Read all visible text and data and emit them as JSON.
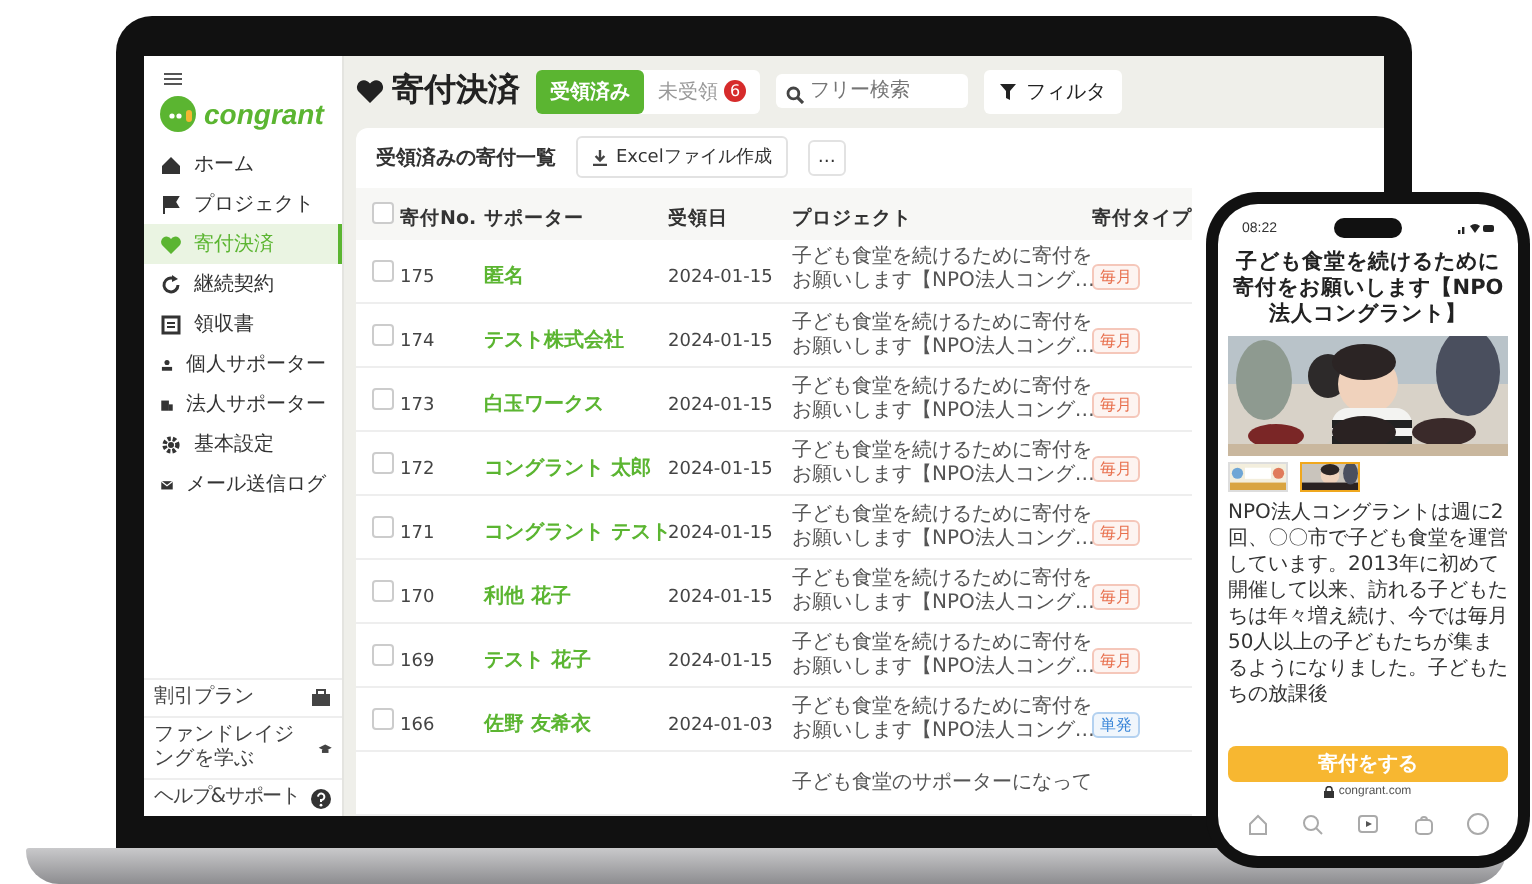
{
  "sidebar": {
    "logo": "congrant",
    "items": [
      {
        "label": "ホーム",
        "selected": false
      },
      {
        "label": "プロジェクト",
        "selected": false
      },
      {
        "label": "寄付決済",
        "selected": true
      },
      {
        "label": "継続契約",
        "selected": false
      },
      {
        "label": "領収書",
        "selected": false
      },
      {
        "label": "個人サポーター",
        "selected": false
      },
      {
        "label": "法人サポーター",
        "selected": false
      },
      {
        "label": "基本設定",
        "selected": false
      },
      {
        "label": "メール送信ログ",
        "selected": false
      }
    ],
    "footer_items": [
      {
        "label": "割引プラン"
      },
      {
        "label": "ファンドレイジングを学ぶ"
      },
      {
        "label": "ヘルプ&サポート"
      }
    ]
  },
  "header": {
    "title": "寄付決済",
    "tabs": [
      {
        "label": "受領済み",
        "selected": true
      },
      {
        "label": "未受領",
        "selected": false,
        "badge": "6"
      }
    ],
    "search": {
      "placeholder": "フリー検索"
    },
    "filter_button": "フィルタ"
  },
  "card": {
    "title": "受領済みの寄付一覧",
    "export_button": "Excelファイル作成",
    "more_button": "…",
    "table": {
      "all_checked": false,
      "columns": [
        "寄付No.",
        "サポーター",
        "受領日",
        "プロジェクト",
        "寄付タイプ"
      ],
      "rows": [
        {
          "checked": false,
          "no": "175",
          "supporter": "匿名",
          "date": "2024-01-15",
          "project": [
            "子ども食堂を続けるために寄付を",
            "お願いします【NPO法人コング…"
          ],
          "type": {
            "label": "毎月",
            "color": "#e8704e"
          }
        },
        {
          "checked": false,
          "no": "174",
          "supporter": "テスト株式会社",
          "date": "2024-01-15",
          "project": [
            "子ども食堂を続けるために寄付を",
            "お願いします【NPO法人コング…"
          ],
          "type": {
            "label": "毎月",
            "color": "#e8704e"
          }
        },
        {
          "checked": false,
          "no": "173",
          "supporter": "白玉ワークス",
          "date": "2024-01-15",
          "project": [
            "子ども食堂を続けるために寄付を",
            "お願いします【NPO法人コング…"
          ],
          "type": {
            "label": "毎月",
            "color": "#e8704e"
          }
        },
        {
          "checked": false,
          "no": "172",
          "supporter": "コングラント 太郎",
          "date": "2024-01-15",
          "project": [
            "子ども食堂を続けるために寄付を",
            "お願いします【NPO法人コング…"
          ],
          "type": {
            "label": "毎月",
            "color": "#e8704e"
          }
        },
        {
          "checked": false,
          "no": "171",
          "supporter": "コングラント テスト",
          "date": "2024-01-15",
          "project": [
            "子ども食堂を続けるために寄付を",
            "お願いします【NPO法人コング…"
          ],
          "type": {
            "label": "毎月",
            "color": "#e8704e"
          }
        },
        {
          "checked": false,
          "no": "170",
          "supporter": "利他 花子",
          "date": "2024-01-15",
          "project": [
            "子ども食堂を続けるために寄付を",
            "お願いします【NPO法人コング…"
          ],
          "type": {
            "label": "毎月",
            "color": "#e8704e"
          }
        },
        {
          "checked": false,
          "no": "169",
          "supporter": "テスト 花子",
          "date": "2024-01-15",
          "project": [
            "子ども食堂を続けるために寄付を",
            "お願いします【NPO法人コング…"
          ],
          "type": {
            "label": "毎月",
            "color": "#e8704e"
          }
        },
        {
          "checked": false,
          "no": "166",
          "supporter": "佐野 友希衣",
          "date": "2024-01-03",
          "project": [
            "子ども食堂を続けるために寄付を",
            "お願いします【NPO法人コング…"
          ],
          "type": {
            "label": "単発",
            "color": "#3a86d8"
          }
        },
        {
          "project": [
            "子ども食堂のサポーターになって"
          ]
        }
      ]
    }
  },
  "phone": {
    "time": "08:22",
    "title": "子ども食堂を続けるために寄付をお願いします【NPO法人コングラント】",
    "thumbnails": [
      {
        "selected": false
      },
      {
        "selected": true
      }
    ],
    "body": "NPO法人コングラントは週に2回、〇〇市で子ども食堂を運営しています。2013年に初めて開催して以来、訪れる子どもたちは年々増え続け、今では毎月50人以上の子どもたちが集まるようになりました。子どもたちの放課後",
    "donate_button": "寄付をする",
    "url": "congrant.com"
  }
}
